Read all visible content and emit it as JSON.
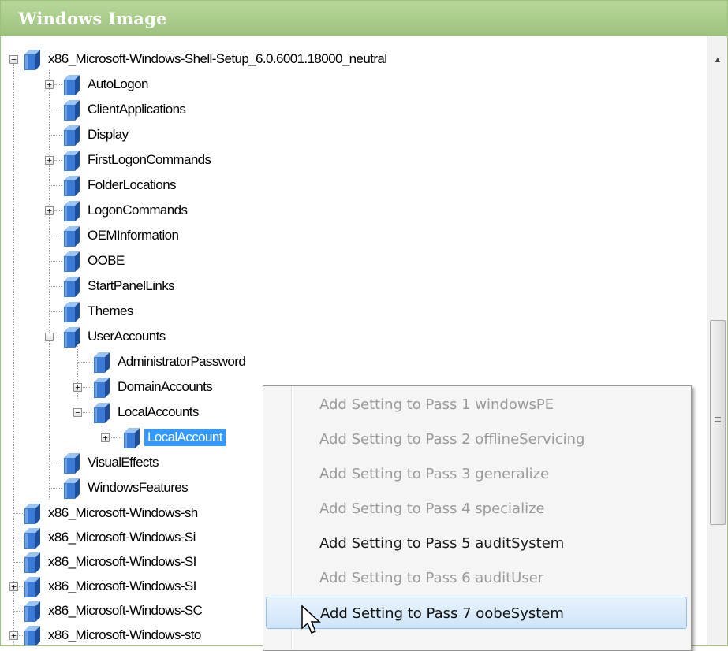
{
  "panel": {
    "title": "Windows Image"
  },
  "tree": {
    "root": "x86_Microsoft-Windows-Shell-Setup_6.0.6001.18000_neutral",
    "children": [
      {
        "label": "AutoLogon",
        "expandable": true
      },
      {
        "label": "ClientApplications",
        "expandable": false
      },
      {
        "label": "Display",
        "expandable": false
      },
      {
        "label": "FirstLogonCommands",
        "expandable": true
      },
      {
        "label": "FolderLocations",
        "expandable": false
      },
      {
        "label": "LogonCommands",
        "expandable": true
      },
      {
        "label": "OEMInformation",
        "expandable": false
      },
      {
        "label": "OOBE",
        "expandable": false
      },
      {
        "label": "StartPanelLinks",
        "expandable": false
      },
      {
        "label": "Themes",
        "expandable": false
      },
      {
        "label": "UserAccounts",
        "expandable": true,
        "expanded": true
      }
    ],
    "user_accounts": [
      {
        "label": "AdministratorPassword",
        "expandable": false
      },
      {
        "label": "DomainAccounts",
        "expandable": true
      },
      {
        "label": "LocalAccounts",
        "expandable": true,
        "expanded": true
      }
    ],
    "local_account": {
      "label": "LocalAccount",
      "selected": true
    },
    "after_user_accounts": [
      {
        "label": "VisualEffects"
      },
      {
        "label": "WindowsFeatures"
      }
    ],
    "siblings": [
      {
        "label": "x86_Microsoft-Windows-sh",
        "expandable": false
      },
      {
        "label": "x86_Microsoft-Windows-Si",
        "expandable": false
      },
      {
        "label": "x86_Microsoft-Windows-SI",
        "expandable": false
      },
      {
        "label": "x86_Microsoft-Windows-SI",
        "expandable": true
      },
      {
        "label": "x86_Microsoft-Windows-SC",
        "expandable": false
      },
      {
        "label": "x86_Microsoft-Windows-sto",
        "expandable": true
      }
    ]
  },
  "context_menu": {
    "items": [
      {
        "label": "Add Setting to Pass 1 windowsPE",
        "enabled": false
      },
      {
        "label": "Add Setting to Pass 2 offlineServicing",
        "enabled": false
      },
      {
        "label": "Add Setting to Pass 3 generalize",
        "enabled": false
      },
      {
        "label": "Add Setting to Pass 4 specialize",
        "enabled": false
      },
      {
        "label": "Add Setting to Pass 5 auditSystem",
        "enabled": true
      },
      {
        "label": "Add Setting to Pass 6 auditUser",
        "enabled": false
      },
      {
        "label": "Add Setting to Pass 7 oobeSystem",
        "enabled": true,
        "highlighted": true
      }
    ]
  },
  "colors": {
    "title_bar": "#9cc27e",
    "selection": "#3399ff",
    "cube_front": "#3b7bd6",
    "cube_top": "#9cc4f2",
    "cube_side": "#1f4f9a",
    "menu_highlight_border": "#8ebde9"
  }
}
